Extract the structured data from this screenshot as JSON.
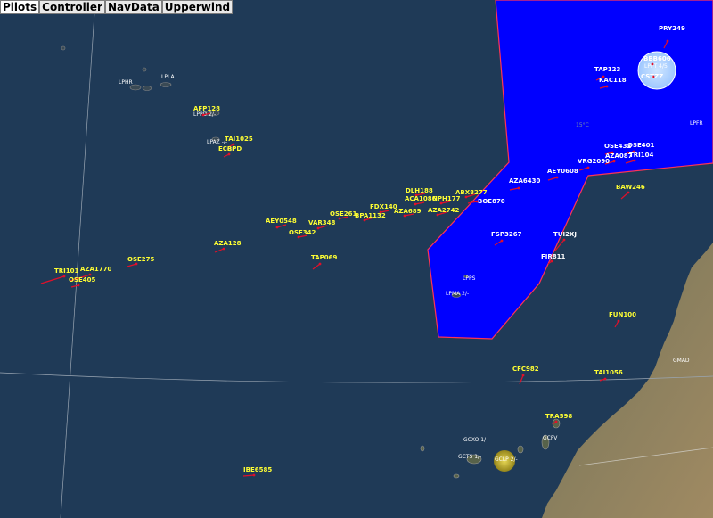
{
  "tabs": [
    "Pilots",
    "Controller",
    "NavData",
    "Upperwind"
  ],
  "colors": {
    "ocean": "#1f3a57",
    "sector": "#0000ff",
    "sector_border": "#ff3355",
    "callsign": "#ffff33",
    "callsign_in_sector": "#ffffff",
    "track": "#e0102a"
  },
  "sector_tag": "15°C",
  "airport_labels": [
    "LPHR",
    "LPLA",
    "LPPD 2/-",
    "LPAZ -/-",
    "LPPS",
    "LPMA 2/-",
    "LPPT 4/5",
    "LPFR",
    "GMAD",
    "GCLP 2/-",
    "GCTS 1/-",
    "GCXO 1/-",
    "GCFV"
  ],
  "aircraft": [
    {
      "callsign": "PRY249",
      "in_sector": true
    },
    {
      "callsign": "BBB606",
      "in_sector": true
    },
    {
      "callsign": "CSTZZ",
      "in_sector": true
    },
    {
      "callsign": "TAP123",
      "in_sector": true
    },
    {
      "callsign": "KAC118",
      "in_sector": true
    },
    {
      "callsign": "OSE432",
      "in_sector": true
    },
    {
      "callsign": "OSE401",
      "in_sector": true
    },
    {
      "callsign": "AZA087",
      "in_sector": true
    },
    {
      "callsign": "TRI104",
      "in_sector": true
    },
    {
      "callsign": "VRG2090",
      "in_sector": true
    },
    {
      "callsign": "AEY0608",
      "in_sector": true
    },
    {
      "callsign": "AZA6430",
      "in_sector": true
    },
    {
      "callsign": "BOE870",
      "in_sector": true
    },
    {
      "callsign": "FSP3267",
      "in_sector": true
    },
    {
      "callsign": "TUI2XJ",
      "in_sector": true
    },
    {
      "callsign": "FIR811",
      "in_sector": true
    },
    {
      "callsign": "BAW246",
      "in_sector": false
    },
    {
      "callsign": "AFP128",
      "in_sector": false
    },
    {
      "callsign": "TAI1025",
      "in_sector": false
    },
    {
      "callsign": "ECBPD",
      "in_sector": false
    },
    {
      "callsign": "DLH188",
      "in_sector": false
    },
    {
      "callsign": "ABX8277",
      "in_sector": false
    },
    {
      "callsign": "ACA1086",
      "in_sector": false
    },
    {
      "callsign": "NPH177",
      "in_sector": false
    },
    {
      "callsign": "FDX140",
      "in_sector": false
    },
    {
      "callsign": "AZA689",
      "in_sector": false
    },
    {
      "callsign": "AZA2742",
      "in_sector": false
    },
    {
      "callsign": "OSE261",
      "in_sector": false
    },
    {
      "callsign": "BPA1132",
      "in_sector": false
    },
    {
      "callsign": "AEY0548",
      "in_sector": false
    },
    {
      "callsign": "VAR348",
      "in_sector": false
    },
    {
      "callsign": "OSE342",
      "in_sector": false
    },
    {
      "callsign": "AZA128",
      "in_sector": false
    },
    {
      "callsign": "TAP069",
      "in_sector": false
    },
    {
      "callsign": "OSE275",
      "in_sector": false
    },
    {
      "callsign": "TRI101",
      "in_sector": false
    },
    {
      "callsign": "AZA1770",
      "in_sector": false
    },
    {
      "callsign": "OSE405",
      "in_sector": false
    },
    {
      "callsign": "FUN100",
      "in_sector": false
    },
    {
      "callsign": "CFC982",
      "in_sector": false
    },
    {
      "callsign": "TAI1056",
      "in_sector": false
    },
    {
      "callsign": "TRA598",
      "in_sector": false
    },
    {
      "callsign": "IBE6585",
      "in_sector": false
    }
  ]
}
